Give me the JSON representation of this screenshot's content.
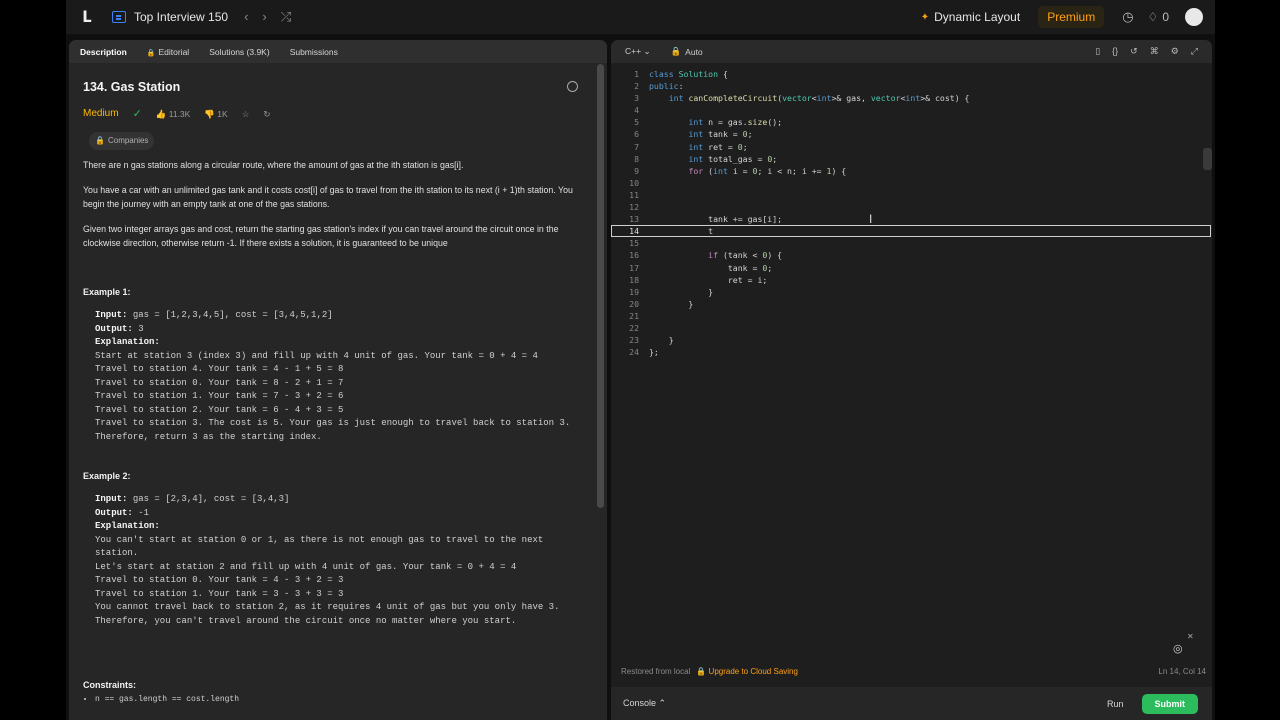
{
  "topbar": {
    "list_title": "Top Interview 150",
    "dynamic_layout": "Dynamic Layout",
    "premium": "Premium",
    "streak": "0"
  },
  "tabs": [
    "Description",
    "Editorial",
    "Solutions (3.9K)",
    "Submissions"
  ],
  "problem": {
    "title": "134. Gas Station",
    "difficulty": "Medium",
    "likes": "11.3K",
    "dislikes": "1K",
    "companies": "Companies",
    "p1": "There are n gas stations along a circular route, where the amount of gas at the ith station is gas[i].",
    "p2": "You have a car with an unlimited gas tank and it costs cost[i] of gas to travel from the ith station to its next (i + 1)th station. You begin the journey with an empty tank at one of the gas stations.",
    "p3": "Given two integer arrays gas and cost, return the starting gas station's index if you can travel around the circuit once in the clockwise direction, otherwise return -1. If there exists a solution, it is guaranteed to be unique",
    "example1": {
      "heading": "Example 1:",
      "input": "gas = [1,2,3,4,5], cost = [3,4,5,1,2]",
      "output": "3",
      "explanation": [
        "Start at station 3 (index 3) and fill up with 4 unit of gas. Your tank = 0 + 4 = 4",
        "Travel to station 4. Your tank = 4 - 1 + 5 = 8",
        "Travel to station 0. Your tank = 8 - 2 + 1 = 7",
        "Travel to station 1. Your tank = 7 - 3 + 2 = 6",
        "Travel to station 2. Your tank = 6 - 4 + 3 = 5",
        "Travel to station 3. The cost is 5. Your gas is just enough to travel back to station 3.",
        "Therefore, return 3 as the starting index."
      ]
    },
    "example2": {
      "heading": "Example 2:",
      "input": "gas = [2,3,4], cost = [3,4,3]",
      "output": "-1",
      "explanation": [
        "You can't start at station 0 or 1, as there is not enough gas to travel to the next station.",
        "Let's start at station 2 and fill up with 4 unit of gas. Your tank = 0 + 4 = 4",
        "Travel to station 0. Your tank = 4 - 3 + 2 = 3",
        "Travel to station 1. Your tank = 3 - 3 + 3 = 3",
        "You cannot travel back to station 2, as it requires 4 unit of gas but you only have 3.",
        "Therefore, you can't travel around the circuit once no matter where you start."
      ]
    },
    "constraints_heading": "Constraints:",
    "constraint1": "n == gas.length == cost.length",
    "labels": {
      "input": "Input:",
      "output": "Output:",
      "explanation": "Explanation:"
    }
  },
  "editor": {
    "language": "C++",
    "mode": "Auto",
    "current_line": 14,
    "lines": [
      "class Solution {",
      "public:",
      "    int canCompleteCircuit(vector<int>& gas, vector<int>& cost) {",
      "",
      "        int n = gas.size();",
      "        int tank = 0;",
      "        int ret = 0;",
      "        int total_gas = 0;",
      "        for (int i = 0; i < n; i += 1) {",
      "",
      "",
      "",
      "            tank += gas[i];",
      "            t",
      "",
      "            if (tank < 0) {",
      "                tank = 0;",
      "                ret = i;",
      "            }",
      "        }",
      "",
      "",
      "    }",
      "};"
    ],
    "status_left": "Restored from local",
    "upgrade": "Upgrade to Cloud Saving",
    "position": "Ln 14, Col 14"
  },
  "bottom": {
    "console": "Console",
    "run": "Run",
    "submit": "Submit"
  },
  "colors": {
    "accent": "#ffa116",
    "submit": "#2cbb5d",
    "medium": "#ffb800"
  }
}
